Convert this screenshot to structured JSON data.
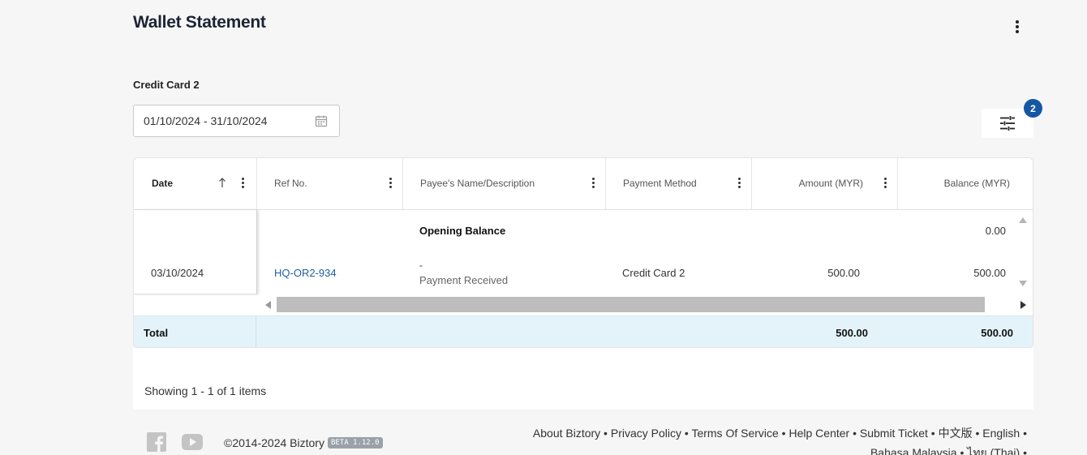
{
  "page": {
    "title": "Wallet Statement"
  },
  "wallet": {
    "name": "Credit Card 2"
  },
  "filters": {
    "date_range": "01/10/2024 - 31/10/2024",
    "badge_count": "2"
  },
  "table": {
    "columns": [
      "Date",
      "Ref No.",
      "Payee's Name/Description",
      "Payment Method",
      "Amount (MYR)",
      "Balance (MYR)"
    ],
    "opening": {
      "label": "Opening Balance",
      "balance": "0.00"
    },
    "rows": [
      {
        "date": "03/10/2024",
        "ref": "HQ-OR2-934",
        "payee": "-",
        "description": "Payment Received",
        "method": "Credit Card 2",
        "amount": "500.00",
        "balance": "500.00"
      }
    ],
    "total": {
      "label": "Total",
      "amount": "500.00",
      "balance": "500.00"
    }
  },
  "pager": {
    "text": "Showing 1 - 1 of 1 items"
  },
  "footer": {
    "copyright": "©2014-2024 Biztory",
    "beta": "BETA 1.12.0",
    "links": [
      "About Biztory",
      "Privacy Policy",
      "Terms Of Service",
      "Help Center",
      "Submit Ticket",
      "中文版",
      "English",
      "Bahasa Malaysia",
      "ไทย (Thai)"
    ],
    "icons": [
      "facebook-icon",
      "youtube-icon"
    ]
  },
  "colors": {
    "accent": "#1557a3",
    "total_bg": "#e4f3fa",
    "link": "#1f5f9e"
  }
}
